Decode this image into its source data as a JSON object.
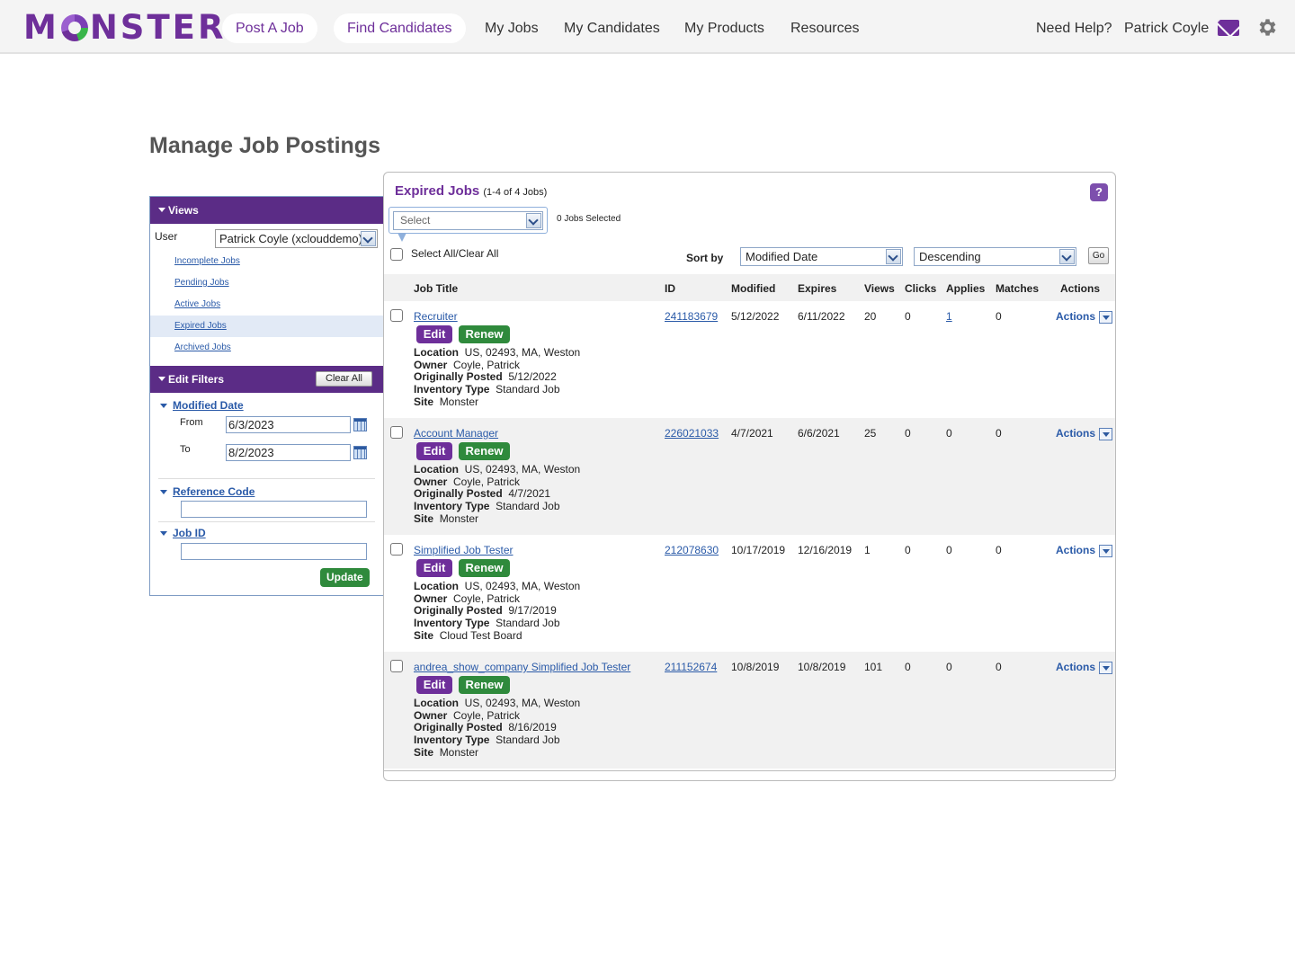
{
  "nav": {
    "logo": [
      "M",
      "NSTER"
    ],
    "post_job": "Post A Job",
    "find_candidates": "Find Candidates",
    "my_jobs": "My Jobs",
    "my_candidates": "My Candidates",
    "my_products": "My Products",
    "resources": "Resources",
    "need_help": "Need Help?",
    "user_name": "Patrick Coyle",
    "mail_icon": "envelope-icon",
    "settings_icon": "gear-icon",
    "brand_color": "#6e2f9a"
  },
  "page": {
    "title": "Manage Job Postings"
  },
  "sidebar": {
    "views_label": "Views",
    "user_label": "User",
    "user_value": "Patrick Coyle (xclouddemo)",
    "views": [
      {
        "label": "Incomplete Jobs",
        "selected": false
      },
      {
        "label": "Pending Jobs",
        "selected": false
      },
      {
        "label": "Active Jobs",
        "selected": false
      },
      {
        "label": "Expired Jobs",
        "selected": true
      },
      {
        "label": "Archived Jobs",
        "selected": false
      }
    ],
    "filters_label": "Edit Filters",
    "clear_all": "Clear All",
    "modified_date_label": "Modified Date",
    "from_label": "From",
    "from_value": "6/3/2023",
    "to_label": "To",
    "to_value": "8/2/2023",
    "reference_code_label": "Reference Code",
    "job_id_label": "Job ID",
    "update_label": "Update"
  },
  "panel": {
    "title": "Expired Jobs",
    "count": "(1-4 of 4 Jobs)",
    "help": "?",
    "bulk_placeholder": "Select",
    "jobs_selected": "0 Jobs Selected",
    "select_all": "Select All/Clear All",
    "sort_by_label": "Sort by",
    "sort_field": "Modified Date",
    "sort_order": "Descending",
    "go": "Go",
    "columns": {
      "title": "Job Title",
      "id": "ID",
      "modified": "Modified",
      "expires": "Expires",
      "views": "Views",
      "clicks": "Clicks",
      "applies": "Applies",
      "matches": "Matches",
      "actions": "Actions"
    },
    "edit_label": "Edit",
    "renew_label": "Renew",
    "actions_label": "Actions",
    "detail_labels": {
      "location": "Location",
      "owner": "Owner",
      "posted": "Originally Posted",
      "inventory": "Inventory Type",
      "site": "Site"
    },
    "jobs": [
      {
        "title": "Recruiter",
        "id": "241183679",
        "modified": "5/12/2022",
        "expires": "6/11/2022",
        "views": "20",
        "clicks": "0",
        "applies": "1",
        "matches": "0",
        "location": "US, 02493, MA, Weston",
        "owner": "Coyle, Patrick",
        "posted": "5/12/2022",
        "inventory": "Standard Job",
        "site": "Monster"
      },
      {
        "title": "Account Manager",
        "id": "226021033",
        "modified": "4/7/2021",
        "expires": "6/6/2021",
        "views": "25",
        "clicks": "0",
        "applies": "0",
        "matches": "0",
        "location": "US, 02493, MA, Weston",
        "owner": "Coyle, Patrick",
        "posted": "4/7/2021",
        "inventory": "Standard Job",
        "site": "Monster"
      },
      {
        "title": "Simplified Job Tester",
        "id": "212078630",
        "modified": "10/17/2019",
        "expires": "12/16/2019",
        "views": "1",
        "clicks": "0",
        "applies": "0",
        "matches": "0",
        "location": "US, 02493, MA, Weston",
        "owner": "Coyle, Patrick",
        "posted": "9/17/2019",
        "inventory": "Standard Job",
        "site": "Cloud Test Board"
      },
      {
        "title": "andrea_show_company Simplified Job Tester",
        "id": "211152674",
        "modified": "10/8/2019",
        "expires": "10/8/2019",
        "views": "101",
        "clicks": "0",
        "applies": "0",
        "matches": "0",
        "location": "US, 02493, MA, Weston",
        "owner": "Coyle, Patrick",
        "posted": "8/16/2019",
        "inventory": "Standard Job",
        "site": "Monster"
      }
    ]
  }
}
